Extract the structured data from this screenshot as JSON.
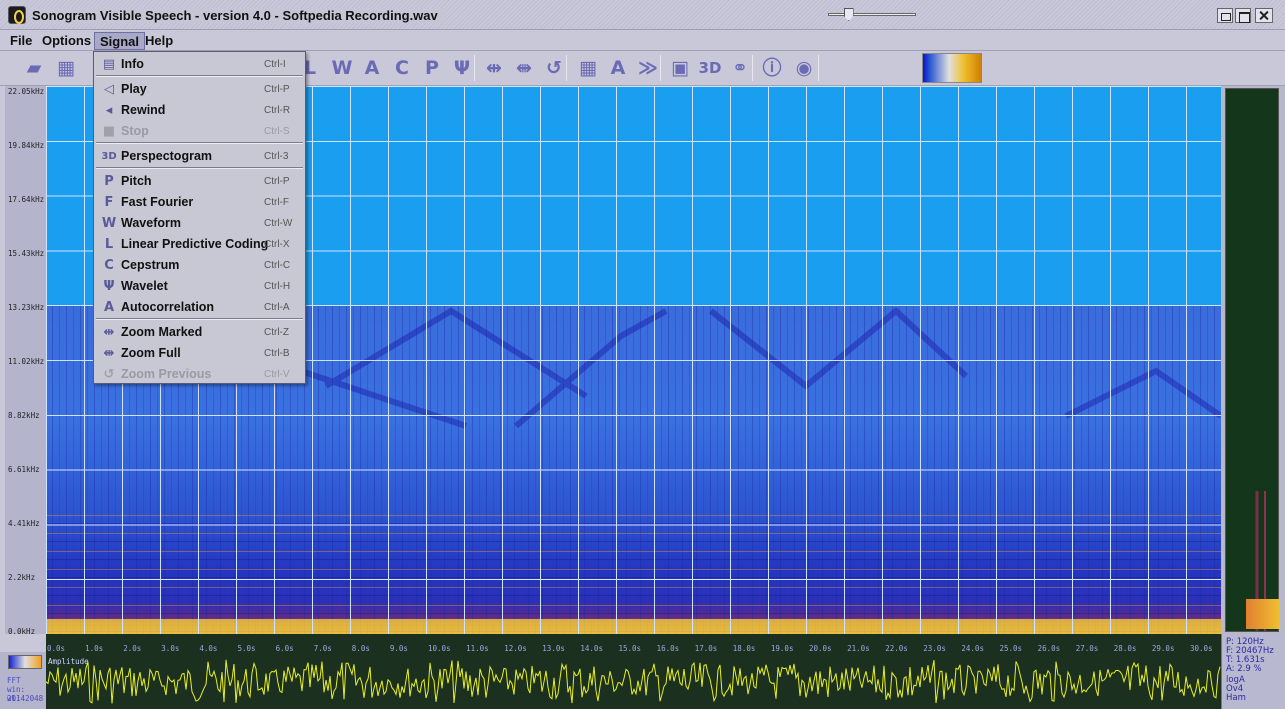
{
  "window": {
    "title": "Sonogram Visible Speech - version 4.0 - Softpedia Recording.wav"
  },
  "menubar": {
    "file": "File",
    "options": "Options",
    "signal": "Signal",
    "help": "Help"
  },
  "signal_menu": {
    "items": [
      {
        "label": "Info",
        "shortcut": "Ctrl-I",
        "icon": "info-icon",
        "enabled": true
      },
      {
        "label": "Play",
        "shortcut": "Ctrl-P",
        "icon": "speaker-icon",
        "enabled": true
      },
      {
        "label": "Rewind",
        "shortcut": "Ctrl-R",
        "icon": "rewind-icon",
        "enabled": true
      },
      {
        "label": "Stop",
        "shortcut": "Ctrl-S",
        "icon": "stop-icon",
        "enabled": false
      },
      {
        "label": "Perspectogram",
        "shortcut": "Ctrl-3",
        "icon": "3d-icon",
        "enabled": true
      },
      {
        "label": "Pitch",
        "shortcut": "Ctrl-P",
        "icon": "pitch-icon",
        "enabled": true
      },
      {
        "label": "Fast Fourier",
        "shortcut": "Ctrl-F",
        "icon": "fourier-icon",
        "enabled": true
      },
      {
        "label": "Waveform",
        "shortcut": "Ctrl-W",
        "icon": "waveform-icon",
        "enabled": true
      },
      {
        "label": "Linear Predictive Coding",
        "shortcut": "Ctrl-X",
        "icon": "lpc-icon",
        "enabled": true
      },
      {
        "label": "Cepstrum",
        "shortcut": "Ctrl-C",
        "icon": "cepstrum-icon",
        "enabled": true
      },
      {
        "label": "Wavelet",
        "shortcut": "Ctrl-H",
        "icon": "wavelet-icon",
        "enabled": true
      },
      {
        "label": "Autocorrelation",
        "shortcut": "Ctrl-A",
        "icon": "autocorrelation-icon",
        "enabled": true
      },
      {
        "label": "Zoom Marked",
        "shortcut": "Ctrl-Z",
        "icon": "zoom-marked-icon",
        "enabled": true
      },
      {
        "label": "Zoom Full",
        "shortcut": "Ctrl-B",
        "icon": "zoom-full-icon",
        "enabled": true
      },
      {
        "label": "Zoom Previous",
        "shortcut": "Ctrl-V",
        "icon": "zoom-previous-icon",
        "enabled": false
      }
    ]
  },
  "toolbar": {
    "icons": [
      {
        "name": "open-file-icon",
        "glyph": "▰"
      },
      {
        "name": "record-icon",
        "glyph": "▦"
      },
      {
        "name": "lpc-tool-icon",
        "glyph": "L"
      },
      {
        "name": "waveform-tool-icon",
        "glyph": "W"
      },
      {
        "name": "autocorrelation-tool-icon",
        "glyph": "A"
      },
      {
        "name": "cepstrum-tool-icon",
        "glyph": "C"
      },
      {
        "name": "pitch-tool-icon",
        "glyph": "P"
      },
      {
        "name": "wavelet-tool-icon",
        "glyph": "Ψ"
      },
      {
        "name": "zoom-marked-tool-icon",
        "glyph": "⇹"
      },
      {
        "name": "zoom-full-tool-icon",
        "glyph": "⇼"
      },
      {
        "name": "zoom-previous-tool-icon",
        "glyph": "↺"
      },
      {
        "name": "grid-tool-icon",
        "glyph": "▦"
      },
      {
        "name": "log-tool-icon",
        "glyph": "A"
      },
      {
        "name": "play-tool-icon",
        "glyph": "≫"
      },
      {
        "name": "perspectogram-tool-icon",
        "glyph": "▣"
      },
      {
        "name": "3d-tool-icon",
        "glyph": "3D"
      },
      {
        "name": "binoculars-tool-icon",
        "glyph": "⚭"
      },
      {
        "name": "info-tool-icon",
        "glyph": "ⓘ"
      },
      {
        "name": "about-tool-icon",
        "glyph": "◉"
      }
    ],
    "slider_level": 0.2
  },
  "frequency_axis": {
    "labels": [
      "22.05kHz",
      "19.84kHz",
      "17.64kHz",
      "15.43kHz",
      "13.23kHz",
      "11.02kHz",
      "8.82kHz",
      "6.61kHz",
      "4.41kHz",
      "2.2kHz",
      "0.0kHz"
    ]
  },
  "time_axis": {
    "labels": [
      "0.0s",
      "1.0s",
      "2.0s",
      "3.0s",
      "4.0s",
      "5.0s",
      "6.0s",
      "7.0s",
      "8.0s",
      "9.0s",
      "10.0s",
      "11.0s",
      "12.0s",
      "13.0s",
      "14.0s",
      "15.0s",
      "16.0s",
      "17.0s",
      "18.0s",
      "19.0s",
      "20.0s",
      "21.0s",
      "22.0s",
      "23.0s",
      "24.0s",
      "25.0s",
      "26.0s",
      "27.0s",
      "28.0s",
      "29.0s",
      "30.0s"
    ]
  },
  "waveform_panel": {
    "label": "Amplitude"
  },
  "left_bottom": {
    "fft": "FFT",
    "win": "win: 2014",
    "wl": "wl: 2048"
  },
  "info_panel": {
    "p": "P: 120Hz",
    "f": "F: 20467Hz",
    "t": "T: 1.631s",
    "a": "A: 2.9 %",
    "log": "logA",
    "ov": "Ov4",
    "ham": "Ham"
  },
  "colors": {
    "spectrogram_bg": "#1a9ef0",
    "waveform_line": "#e8f020",
    "waveform_bg": "#1c3020"
  }
}
